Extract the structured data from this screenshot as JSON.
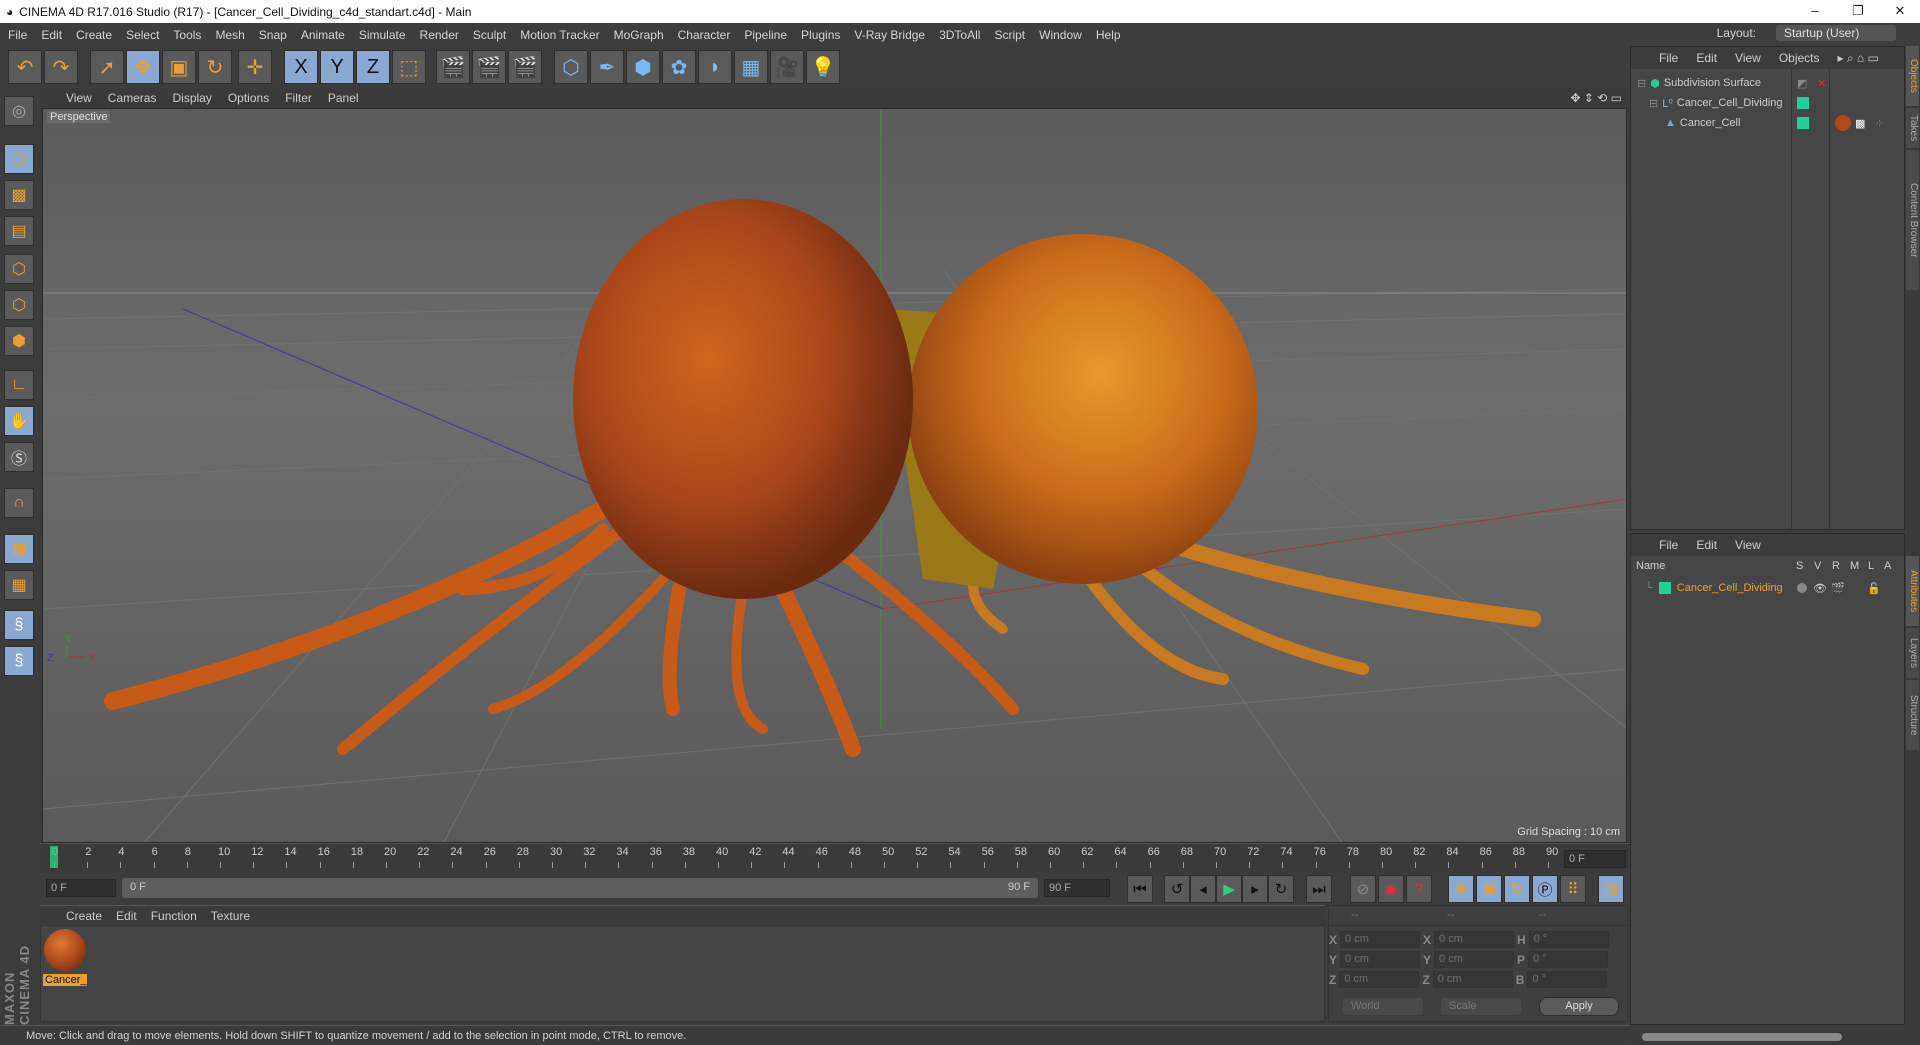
{
  "window": {
    "title": "CINEMA 4D R17.016 Studio (R17) - [Cancer_Cell_Dividing_c4d_standart.c4d] - Main",
    "minimize": "–",
    "restore": "❐",
    "close": "✕"
  },
  "menu": [
    "File",
    "Edit",
    "Create",
    "Select",
    "Tools",
    "Mesh",
    "Snap",
    "Animate",
    "Simulate",
    "Render",
    "Sculpt",
    "Motion Tracker",
    "MoGraph",
    "Character",
    "Pipeline",
    "Plugins",
    "V-Ray Bridge",
    "3DToAll",
    "Script",
    "Window",
    "Help"
  ],
  "layout": {
    "label": "Layout:",
    "value": "Startup (User)"
  },
  "toolbar": {
    "icons": [
      "undo-icon",
      "redo-icon",
      "select-icon",
      "move-icon",
      "scale-icon",
      "rotate-icon",
      "transform-icon",
      "x-axis-icon",
      "y-axis-icon",
      "z-axis-icon",
      "world-coords-icon",
      "render-view-icon",
      "render-picture-viewer-icon",
      "render-settings-icon",
      "cube-icon",
      "pen-icon",
      "subdivision-icon",
      "mograph-icon",
      "deformer-icon",
      "floor-icon",
      "camera-icon",
      "light-icon"
    ],
    "glyphs": [
      "↶",
      "↷",
      "➚",
      "✥",
      "▣",
      "↻",
      "✛",
      "X",
      "Y",
      "Z",
      "⬚",
      "🎬",
      "🎬",
      "🎬",
      "⬡",
      "✒",
      "⬢",
      "✿",
      "◗",
      "▦",
      "🎥",
      "💡"
    ]
  },
  "viewport": {
    "menu": [
      "View",
      "Cameras",
      "Display",
      "Options",
      "Filter",
      "Panel"
    ],
    "label": "Perspective",
    "grid_spacing": "Grid Spacing : 10 cm",
    "axis": {
      "x": "X",
      "y": "Y",
      "z": "Z"
    }
  },
  "timeline": {
    "start": 0,
    "end": 90,
    "step": 2,
    "current_frame": "0 F",
    "range_start": "0 F",
    "range_slider_start": "0 F",
    "range_slider_end": "90 F",
    "range_end": "90 F"
  },
  "material_panel": {
    "menu": [
      "Create",
      "Edit",
      "Function",
      "Texture"
    ],
    "materials": [
      {
        "name": "Cancer_"
      }
    ]
  },
  "coordinates": {
    "headers": [
      "--",
      "--",
      "--"
    ],
    "rows": [
      {
        "a": "X",
        "av": "0 cm",
        "b": "X",
        "bv": "0 cm",
        "c": "H",
        "cv": "0 °"
      },
      {
        "a": "Y",
        "av": "0 cm",
        "b": "Y",
        "bv": "0 cm",
        "c": "P",
        "cv": "0 °"
      },
      {
        "a": "Z",
        "av": "0 cm",
        "b": "Z",
        "bv": "0 cm",
        "c": "B",
        "cv": "0 °"
      }
    ],
    "mode": "World",
    "type": "Scale",
    "apply": "Apply"
  },
  "status": "Move: Click and drag to move elements. Hold down SHIFT to quantize movement / add to the selection in point mode, CTRL to remove.",
  "objects_panel": {
    "menu": [
      "File",
      "Edit",
      "View",
      "Objects"
    ],
    "items": [
      {
        "name": "Subdivision Surface",
        "depth": 0
      },
      {
        "name": "Cancer_Cell_Dividing",
        "depth": 1
      },
      {
        "name": "Cancer_Cell",
        "depth": 2
      }
    ]
  },
  "layers_panel": {
    "menu": [
      "File",
      "Edit",
      "View"
    ],
    "columns": [
      "Name",
      "S",
      "V",
      "R",
      "M",
      "L",
      "A"
    ],
    "items": [
      {
        "name": "Cancer_Cell_Dividing"
      }
    ]
  },
  "side_tabs": [
    "Objects",
    "Takes",
    "Content Browser",
    "Attributes",
    "Layers",
    "Structure"
  ],
  "logo": "MAXON CINEMA 4D",
  "colors": {
    "accent": "#e8a030",
    "green": "#20d09a",
    "layer_text": "#e8a030"
  }
}
